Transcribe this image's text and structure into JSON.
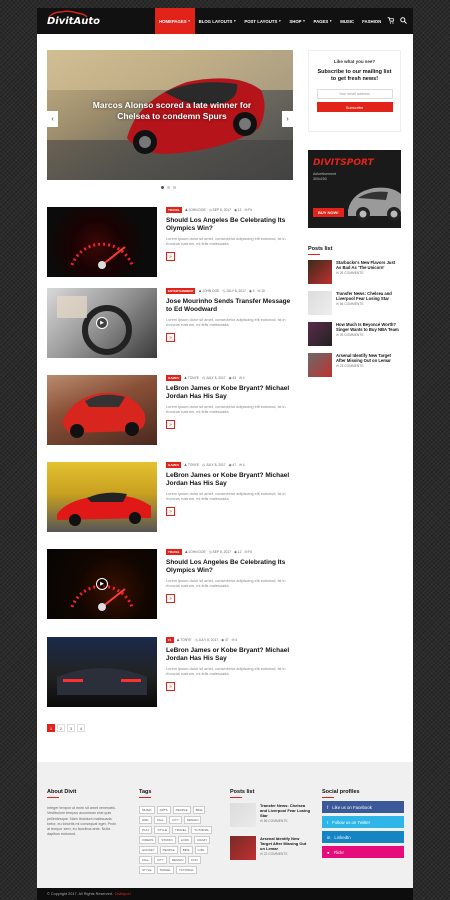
{
  "header": {
    "logo": "DivitAuto",
    "nav": [
      {
        "label": "HOMEPAGES",
        "active": true,
        "caret": true
      },
      {
        "label": "BLOG LAYOUTS",
        "active": false,
        "caret": true
      },
      {
        "label": "POST LAYOUTS",
        "active": false,
        "caret": true
      },
      {
        "label": "SHOP",
        "active": false,
        "caret": true
      },
      {
        "label": "PAGES",
        "active": false,
        "caret": true
      },
      {
        "label": "MUSIC",
        "active": false,
        "caret": false
      },
      {
        "label": "FASHION",
        "active": false,
        "caret": false
      }
    ],
    "icons": [
      "cart-icon",
      "search-icon"
    ]
  },
  "slider": {
    "title": "Marcos Alonso scored a late winner for Chelsea to condemn Spurs",
    "prev": "‹",
    "next": "›"
  },
  "subscribe": {
    "question": "Like what you see?",
    "title": "Subscribe to our mailing list to get fresh news!",
    "email_placeholder": "Your email address",
    "button": "Subscribe"
  },
  "ad": {
    "brand": "DIVITSPORT",
    "line1": "Advertisement",
    "line2": "300x250",
    "button": "BUY NOW!"
  },
  "sidebar_posts": {
    "heading": "Posts list",
    "items": [
      {
        "title": "Starbucks's New Flavors Just As Bad As 'The Unicorn'",
        "meta": "26 COMMENTS"
      },
      {
        "title": "Transfer News: Chelsea and Liverpool Fear Losing Star",
        "meta": "56 COMMENTS"
      },
      {
        "title": "How Much Is Beyoncé Worth? Singer Wants to Buy NBA Team",
        "meta": "25 COMMENTS"
      },
      {
        "title": "Arsenal Identify New Target After Missing Out on Lemar",
        "meta": "22 COMMENTS"
      }
    ]
  },
  "posts": [
    {
      "category": "TRAVEL",
      "author": "JOHN DOE",
      "date": "SEP 8, 2017",
      "views": "12",
      "comments": "Fit",
      "title": "Should Los Angeles Be Celebrating Its Olympics Win?",
      "excerpt": "Lorem ipsum dolor sit amet, consectetur adipiscing elit euismod, ist in rhoncus rustrum, ml felis malesuada.",
      "more": "»"
    },
    {
      "category": "ENTERTAINMENT",
      "author": "JOHN DOE",
      "date": "JULY 8, 2017",
      "views": "3",
      "comments": "10",
      "title": "Jose Mourinho Sends Transfer Message to Ed Woodward",
      "excerpt": "Lorem ipsum dolor sit amet, consectetur adipiscing elit euismod, ist in rhoncus rustrum, ml felis malesuada.",
      "more": "»"
    },
    {
      "category": "GAMES",
      "author": "TONYE",
      "date": "JULY 8, 2017",
      "views": "43",
      "comments": "4",
      "title": "LeBron James or Kobe Bryant? Michael Jordan Has His Say",
      "excerpt": "Lorem ipsum dolor sit amet, consectetur adipiscing elit euismod, ist in rhoncus rustrum, ml felis malesuada.",
      "more": "»"
    },
    {
      "category": "GAMES",
      "author": "TONYE",
      "date": "JULY 8, 2017",
      "views": "47",
      "comments": "4",
      "title": "LeBron James or Kobe Bryant? Michael Jordan Has His Say",
      "excerpt": "Lorem ipsum dolor sit amet, consectetur adipiscing elit euismod, ist in rhoncus rustrum, ml felis malesuada.",
      "more": "»"
    },
    {
      "category": "TRAVEL",
      "author": "JOHN DOE",
      "date": "SEP 8, 2017",
      "views": "12",
      "comments": "Fit",
      "title": "Should Los Angeles Be Celebrating Its Olympics Win?",
      "excerpt": "Lorem ipsum dolor sit amet, consectetur adipiscing elit euismod, ist in rhoncus rustrum, ml felis malesuada.",
      "more": "»"
    },
    {
      "category": "F1",
      "author": "TONYE",
      "date": "JULY 8, 2017",
      "views": "47",
      "comments": "4",
      "title": "LeBron James or Kobe Bryant? Michael Jordan Has His Say",
      "excerpt": "Lorem ipsum dolor sit amet, consectetur adipiscing elit euismod, ist in rhoncus rustrum, ml felis malesuada.",
      "more": "»"
    }
  ],
  "pagination": [
    "1",
    "2",
    "3",
    "4"
  ],
  "footer": {
    "about": {
      "heading": "About Divit",
      "text": "Integer tempor ut enim sit amet venenatis. Vestibulum tempus accumsan erat quis pellentesque. Nam tincidunt malesuada tortor, eu lobortis mi consequat eget. Proin at tempor sem, eu faucibus ante. Nulla dapibus euismod."
    },
    "tags": {
      "heading": "Tags",
      "items": [
        "MUSIC",
        "ARTS",
        "PEOPLE",
        "BIKE",
        "GIRL",
        "FALL",
        "CITY",
        "DESIGN",
        "PLAY",
        "STYLE",
        "TRAVEL",
        "TUTORIAL",
        "VIDEOS",
        "STUDIO",
        "LOOK",
        "CRAZY",
        "HOCKEY",
        "PEOPLE",
        "BIKE",
        "GIRL",
        "FALL",
        "CITY",
        "DESIGN",
        "FUN",
        "STYLE",
        "TRAVEL",
        "TUTORIAL"
      ]
    },
    "posts": {
      "heading": "Posts list",
      "items": [
        {
          "title": "Transfer News: Chelsea and Liverpool Fear Losing Star",
          "meta": "56 COMMENTS"
        },
        {
          "title": "Arsenal Identify New Target After Missing Out on Lemar",
          "meta": "22 COMMENTS"
        }
      ]
    },
    "social": {
      "heading": "Social profiles",
      "items": [
        {
          "label": "Like us on Facebook",
          "color": "#3b5998",
          "icon": "facebook-icon",
          "glyph": "f"
        },
        {
          "label": "Follow us on Twitter",
          "color": "#2eb6e8",
          "icon": "twitter-icon",
          "glyph": "t"
        },
        {
          "label": "LinkedIn",
          "color": "#1484c2",
          "icon": "linkedin-icon",
          "glyph": "in"
        },
        {
          "label": "Flickr",
          "color": "#e60c7c",
          "icon": "flickr-icon",
          "glyph": "●"
        }
      ]
    },
    "copyright": "© Copyright 2017. All Rights Reserved.",
    "copyright_brand": "Divitsport"
  },
  "colors": {
    "accent": "#e2231a",
    "header_bg": "#111111"
  }
}
